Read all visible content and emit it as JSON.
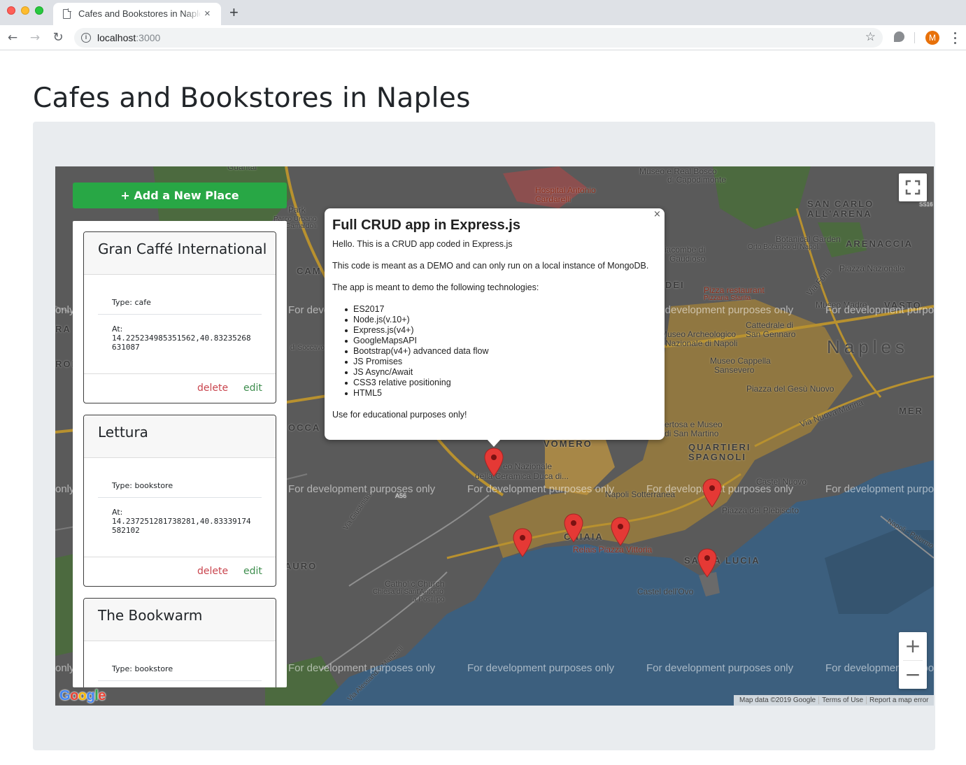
{
  "browser": {
    "tab_title": "Cafes and Bookstores in Naples",
    "tab_close": "×",
    "new_tab": "+",
    "url_host": "localhost",
    "url_port": ":3000",
    "avatar_initial": "M"
  },
  "page": {
    "title": "Cafes and Bookstores in Naples",
    "add_button": "+ Add a New Place"
  },
  "places": [
    {
      "name": "Gran Caffé International",
      "type": "Type: cafe",
      "at_label": "At:",
      "coords": "14.225234985351562,40.83235268631087",
      "delete": "delete",
      "edit": "edit"
    },
    {
      "name": "Lettura",
      "type": "Type: bookstore",
      "at_label": "At:",
      "coords": "14.237251281738281,40.83339174582102",
      "delete": "delete",
      "edit": "edit"
    },
    {
      "name": "The Bookwarm",
      "type": "Type: bookstore",
      "at_label": "",
      "coords": "",
      "delete": "",
      "edit": ""
    }
  ],
  "info_window": {
    "close": "×",
    "title": "Full CRUD app in Express.js",
    "intro": "Hello. This is a CRUD app coded in Express.js",
    "demo_note": "This code is meant as a DEMO and can only run on a local instance of MongoDB.",
    "tech_heading": "The app is meant to demo the following technologies:",
    "technologies": [
      "ES2017",
      "Node.js(v.10+)",
      "Express.js(v4+)",
      "GoogleMapsAPI",
      "Bootstrap(v4+) advanced data flow",
      "JS Promises",
      "JS Async/Await",
      "CSS3 relative positioning",
      "HTML5"
    ],
    "footer": "Use for educational purposes only!"
  },
  "map": {
    "watermark": "For development purposes only",
    "labels": {
      "guantai": "Guantai",
      "museo_bosco": "Museo e Real Bosco",
      "capodimonte": "di Capodimonte",
      "hospital": "Hospital Antonio",
      "cardarelli": "Cardarelli",
      "park": "Park",
      "parco_urbano": "Parco Urbano",
      "camaldoli": "Camaldoli",
      "san_carlo": "SAN CARLO",
      "arena": "ALL'ARENA",
      "botanical": "Botanical Garden",
      "orto": "Orto Botanico di Napoli",
      "arenaccia": "ARENACCIA",
      "piazza_nazionale": "Piazza Nazionale",
      "cam": "CAM",
      "giacombe": "iacombe di",
      "gaudioso": "Gaudioso",
      "dei": "DEI",
      "pizza_restaurant": "Pizza restaurant",
      "pizzaria_starita": "Pizzaria Starita",
      "via_foria": "Via Foria",
      "museo_madre": "Museo Madre",
      "vasto": "VASTO",
      "cattedrale": "Cattedrale di",
      "san_gennaro": "San Gennaro",
      "museo_arch": "Museo Archeologico",
      "nazionale_napoli": "Nazionale di Napoli",
      "naples": "Naples",
      "soccavo": "di Soccavo",
      "cappella": "Museo Cappella",
      "sansevero": "Sansevero",
      "gesu": "Piazza del Gesù Nuovo",
      "mer": "MER",
      "via_nuova_marina": "Via Nuova Marina",
      "certosa": "ertosa e Museo",
      "san_martino": "di San Martino",
      "quartieri": "QUARTIERI",
      "spagnoli": "SPAGNOLI",
      "vomero": "VOMERO",
      "occa": "OCCA",
      "museo_nazionale": "eo Nazionale",
      "ceramica": "della Ceramica Duca di...",
      "castel_nuovo": "Castel Nuovo",
      "napoli_sotterranea": "Napoli Sotterranea",
      "plebiscito": "Piazza del Plebiscito",
      "via_giustiniano": "Via Giustiniano",
      "a56": "A56",
      "s16": "SS16",
      "napoli_palermo": "Napoli - Palermo",
      "chiaia": "CHIAIA",
      "relais": "Relais Piazza Vittoria",
      "santa_lucia": "SANTA LUCIA",
      "auro": "AURO",
      "catholic_church": "Catholic Church",
      "chiesa": "Chiesa di Sant'Antonio",
      "posillipo": "a Posillipo",
      "castel_ovo": "Castel dell'Ovo",
      "via_alessandro": "Via Alessandro Manzoni",
      "ra": "RA",
      "ron": "RON",
      "only": "only"
    },
    "google_logo": "Google",
    "attribution": [
      "Map data ©2019 Google",
      "Terms of Use",
      "Report a map error"
    ],
    "zoom_in": "+",
    "zoom_out": "−",
    "colors": {
      "land": "#5a5a5a",
      "water": "#3c5f7e",
      "park": "#4c6a3f",
      "urban": "#c79a3f",
      "road": "#b8912f",
      "marker": "#e53935"
    }
  }
}
